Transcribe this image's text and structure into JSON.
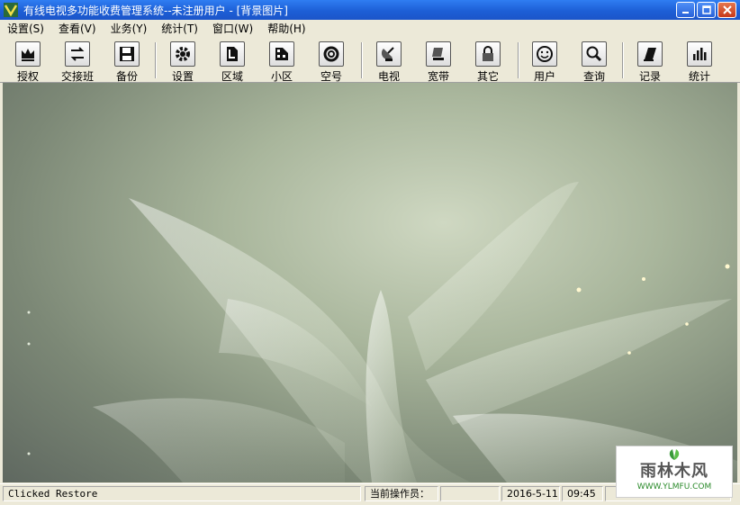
{
  "window": {
    "title": "有线电视多功能收费管理系统--未注册用户 - [背景图片]"
  },
  "menu": [
    {
      "label": "设置(S)"
    },
    {
      "label": "查看(V)"
    },
    {
      "label": "业务(Y)"
    },
    {
      "label": "统计(T)"
    },
    {
      "label": "窗口(W)"
    },
    {
      "label": "帮助(H)"
    }
  ],
  "toolbar": [
    {
      "label": "授权",
      "icon": "crown-icon"
    },
    {
      "label": "交接班",
      "icon": "swap-icon"
    },
    {
      "label": "备份",
      "icon": "floppy-icon"
    },
    {
      "label": "设置",
      "icon": "gear-icon"
    },
    {
      "label": "区域",
      "icon": "area-icon"
    },
    {
      "label": "小区",
      "icon": "grid-icon"
    },
    {
      "label": "空号",
      "icon": "ring-icon"
    },
    {
      "label": "电视",
      "icon": "satellite-icon"
    },
    {
      "label": "宽带",
      "icon": "network-icon"
    },
    {
      "label": "其它",
      "icon": "lock-icon"
    },
    {
      "label": "用户",
      "icon": "smiley-icon"
    },
    {
      "label": "查询",
      "icon": "magnifier-icon"
    },
    {
      "label": "记录",
      "icon": "book-icon"
    },
    {
      "label": "统计",
      "icon": "barchart-icon"
    }
  ],
  "status": {
    "message": "Clicked Restore",
    "operator_label": "当前操作员：",
    "operator_value": "",
    "date": "2016-5-11",
    "time": "09:45"
  },
  "watermark": {
    "brand": "雨林木风",
    "url": "WWW.YLMFU.COM"
  },
  "colors": {
    "titlebar": "#1d5fd6",
    "chrome": "#ece9d8",
    "close_button": "#c8391a"
  }
}
